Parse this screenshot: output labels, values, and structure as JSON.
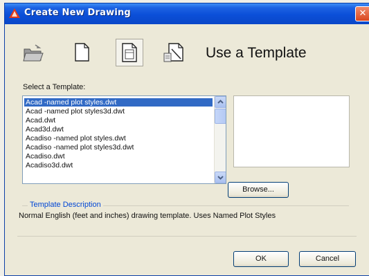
{
  "window": {
    "title": "Create New Drawing",
    "close_glyph": "✕"
  },
  "mode_icons": [
    {
      "name": "open-folder-icon",
      "label": "Open a Drawing"
    },
    {
      "name": "start-from-scratch-icon",
      "label": "Start from Scratch"
    },
    {
      "name": "use-template-icon",
      "label": "Use a Template",
      "active": true
    },
    {
      "name": "use-wizard-icon",
      "label": "Use a Wizard"
    }
  ],
  "heading": "Use a Template",
  "template_list": {
    "label": "Select a Template:",
    "items": [
      "Acad -named plot styles.dwt",
      "Acad -named plot styles3d.dwt",
      "Acad.dwt",
      "Acad3d.dwt",
      "Acadiso -named plot styles.dwt",
      "Acadiso -named plot styles3d.dwt",
      "Acadiso.dwt",
      "Acadiso3d.dwt"
    ],
    "selected_index": 0
  },
  "browse_label": "Browse...",
  "description": {
    "legend": "Template Description",
    "text": "Normal English (feet and inches) drawing template.  Uses Named Plot Styles"
  },
  "buttons": {
    "ok": "OK",
    "cancel": "Cancel"
  },
  "colors": {
    "title_bar": "#0b4fd8",
    "selection": "#316ac5",
    "group_legend": "#0046d5",
    "dialog_bg": "#ece9d8"
  }
}
